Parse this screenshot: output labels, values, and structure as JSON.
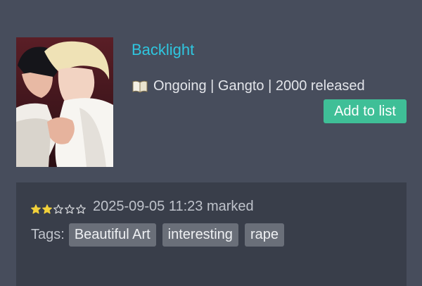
{
  "manga": {
    "title": "Backlight",
    "meta_text": "Ongoing | Gangto | 2000 released",
    "add_button_label": "Add to list",
    "cover_alt": "Backlight cover",
    "book_icon": "open-book-icon"
  },
  "record": {
    "rating": 2,
    "rating_max": 5,
    "marked_text": "2025-09-05 11:23 marked",
    "tags_label": "Tags:",
    "tags": [
      "Beautiful Art",
      "interesting",
      "rape"
    ]
  },
  "colors": {
    "background": "#474d5c",
    "panel": "#393e4a",
    "title": "#2fc6df",
    "accent_button": "#3fbf97",
    "star_filled": "#f2d13a",
    "tag_bg": "#6a6f79"
  }
}
